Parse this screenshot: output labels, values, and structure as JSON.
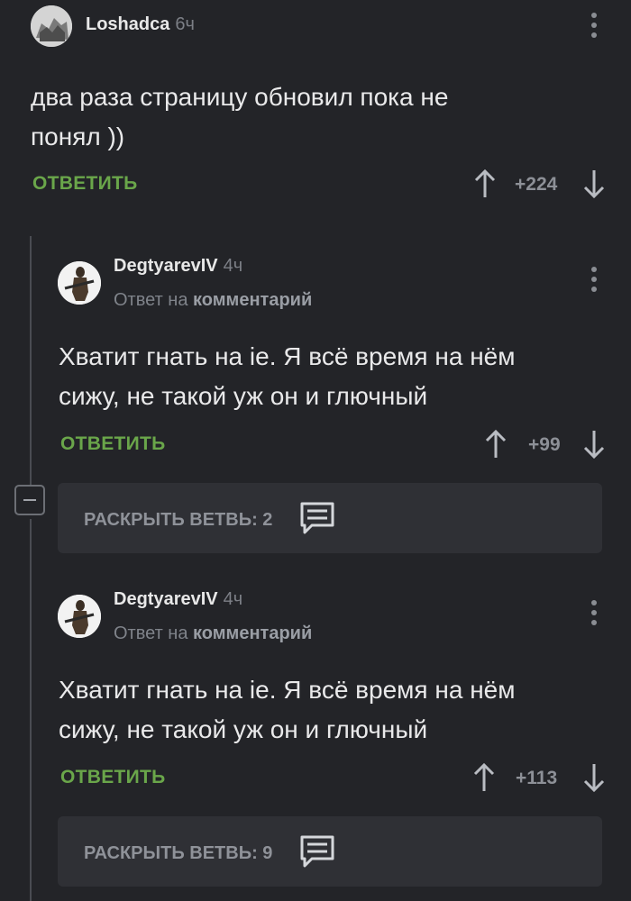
{
  "comments": [
    {
      "author": "Loshadca",
      "time": "6ч",
      "text_lines": [
        "два раза страницу обновил пока не",
        "понял ))"
      ],
      "reply_label": "ОТВЕТИТЬ",
      "score": "+224"
    },
    {
      "author": "DegtyarevIV",
      "time": "4ч",
      "reply_to_prefix": "Ответ на",
      "reply_to_target": "комментарий",
      "text_lines": [
        "Хватит гнать на ie. Я всё время на нём",
        "сижу, не такой уж он и глючный"
      ],
      "reply_label": "ОТВЕТИТЬ",
      "score": "+99",
      "expand_label": "РАСКРЫТЬ ВЕТВЬ: 2"
    },
    {
      "author": "DegtyarevIV",
      "time": "4ч",
      "reply_to_prefix": "Ответ на",
      "reply_to_target": "комментарий",
      "text_lines": [
        "Хватит гнать на ie. Я всё время на нём",
        "сижу, не такой уж он и глючный"
      ],
      "reply_label": "ОТВЕТИТЬ",
      "score": "+113",
      "expand_label": "РАСКРЫТЬ ВЕТВЬ: 9"
    }
  ],
  "icons": {
    "upvote": "arrow-up-icon",
    "downvote": "arrow-down-icon",
    "menu": "more-vertical-icon",
    "comments": "comment-icon",
    "collapse": "minus-icon"
  },
  "colors": {
    "background": "#232428",
    "reply_green": "#6aa64a",
    "panel": "#2f3035"
  }
}
